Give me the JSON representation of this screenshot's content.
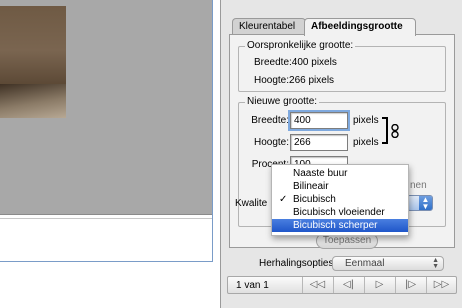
{
  "tabs": [
    {
      "label": "Kleurentabel",
      "active": false
    },
    {
      "label": "Afbeeldingsgrootte",
      "active": true
    }
  ],
  "original_size": {
    "title": "Oorspronkelijke grootte:",
    "width_line": "Breedte:400 pixels",
    "height_line": "Hoogte:266 pixels"
  },
  "new_size": {
    "title": "Nieuwe grootte:",
    "width_label": "Breedte:",
    "width_value": "400",
    "width_unit": "pixels",
    "height_label": "Hoogte:",
    "height_value": "266",
    "height_unit": "pixels",
    "percent_label": "Procent:",
    "percent_value": "100",
    "hidden_checkbox_fragment": "nen",
    "quality_label": "Kwalite"
  },
  "quality_menu": {
    "items": [
      {
        "label": "Naaste buur",
        "checked": false,
        "highlighted": false
      },
      {
        "label": "Bilineair",
        "checked": false,
        "highlighted": false
      },
      {
        "label": "Bicubisch",
        "checked": true,
        "highlighted": false
      },
      {
        "label": "Bicubisch vloeiender",
        "checked": false,
        "highlighted": false
      },
      {
        "label": "Bicubisch scherper",
        "checked": false,
        "highlighted": true
      }
    ],
    "check_glyph": "✓"
  },
  "apply_button": "Toepassen",
  "repeat": {
    "label": "Herhalingsopties:",
    "value": "Eenmaal"
  },
  "navigation": {
    "page_indicator": "1 van 1",
    "first": "◁◁",
    "prev": "◁|",
    "play": "▷",
    "next": "|▷",
    "last": "▷▷"
  },
  "colors": {
    "selection": "#1f56c9",
    "canvas_gray": "#a8a8a8",
    "palette_bg": "#e6e6e6"
  }
}
